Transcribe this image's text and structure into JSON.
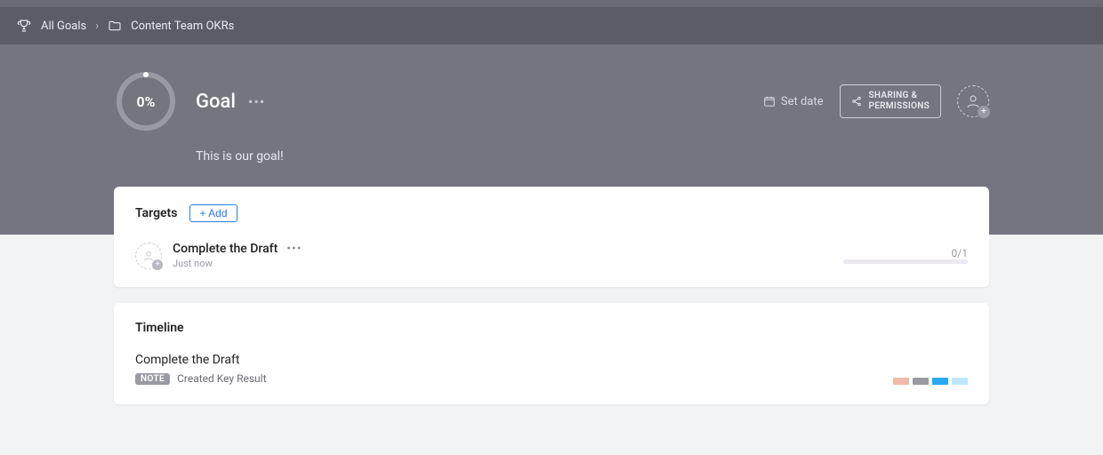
{
  "breadcrumb": {
    "root": "All Goals",
    "folder": "Content Team OKRs"
  },
  "hero": {
    "progress_pct": "0%",
    "title": "Goal",
    "description": "This is our goal!",
    "set_date_label": "Set date",
    "share_line1": "SHARING &",
    "share_line2": "PERMISSIONS"
  },
  "targets": {
    "section_title": "Targets",
    "add_label": "+ Add",
    "items": [
      {
        "name": "Complete the Draft",
        "time": "Just now",
        "fraction": "0/1"
      }
    ]
  },
  "timeline": {
    "section_title": "Timeline",
    "items": [
      {
        "title": "Complete the Draft",
        "badge": "NOTE",
        "text": "Created Key Result"
      }
    ],
    "swatches": [
      "#f2b8a8",
      "#9a9aa3",
      "#29a9f2",
      "#bfe7fb"
    ]
  }
}
